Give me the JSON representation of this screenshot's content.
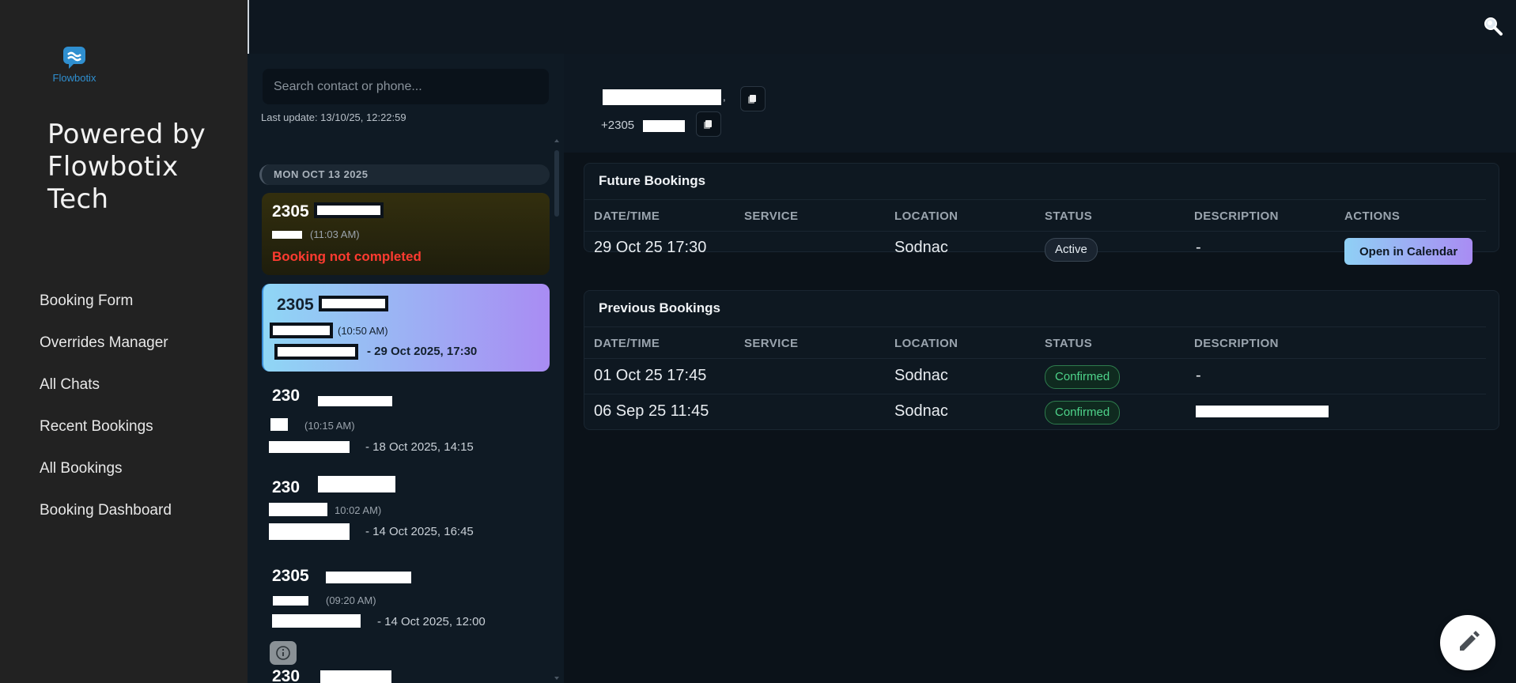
{
  "sidebar": {
    "logo_text": "Flowbotix",
    "powered_by": "Powered by Flowbotix Tech",
    "nav": [
      {
        "label": "Booking Form"
      },
      {
        "label": "Overrides Manager"
      },
      {
        "label": "All Chats"
      },
      {
        "label": "Recent Bookings"
      },
      {
        "label": "All Bookings"
      },
      {
        "label": "Booking Dashboard"
      }
    ]
  },
  "topbar": {
    "search_icon": "magnifier-icon"
  },
  "chat_list": {
    "search_placeholder": "Search contact or phone...",
    "last_update": "Last update: 13/10/25, 12:22:59",
    "date_separator": "MON OCT 13 2025",
    "chats": [
      {
        "phone": "2305",
        "time": "(11:03 AM)",
        "status": "Booking not completed"
      },
      {
        "phone": "2305",
        "time": "(10:50 AM)",
        "booking": "- 29 Oct 2025, 17:30"
      },
      {
        "phone": "230",
        "time": "(10:15 AM)",
        "booking": "- 18 Oct 2025, 14:15"
      },
      {
        "phone": "230",
        "time": "10:02 AM)",
        "booking": "- 14 Oct 2025, 16:45"
      },
      {
        "phone": "2305",
        "time": "(09:20 AM)",
        "booking": "- 14 Oct 2025, 12:00"
      },
      {
        "phone": "230"
      }
    ]
  },
  "contact": {
    "name_suffix": ",",
    "phone_prefix": "+2305"
  },
  "future_bookings": {
    "title": "Future Bookings",
    "columns": [
      "DATE/TIME",
      "SERVICE",
      "LOCATION",
      "STATUS",
      "DESCRIPTION",
      "ACTIONS"
    ],
    "rows": [
      {
        "datetime": "29 Oct 25 17:30",
        "service": "",
        "location": "Sodnac",
        "status": "Active",
        "description": "-",
        "action": "Open in Calendar"
      }
    ]
  },
  "previous_bookings": {
    "title": "Previous Bookings",
    "columns": [
      "DATE/TIME",
      "SERVICE",
      "LOCATION",
      "STATUS",
      "DESCRIPTION"
    ],
    "rows": [
      {
        "datetime": "01 Oct 25 17:45",
        "service": "",
        "location": "Sodnac",
        "status": "Confirmed",
        "description": "-"
      },
      {
        "datetime": "06 Sep 25 11:45",
        "service": "",
        "location": "Sodnac",
        "status": "Confirmed",
        "description": ""
      }
    ]
  },
  "colors": {
    "accent_start": "#8fd0f5",
    "accent_end": "#a98cf3",
    "danger": "#ff3b30",
    "success": "#4ed38a"
  }
}
